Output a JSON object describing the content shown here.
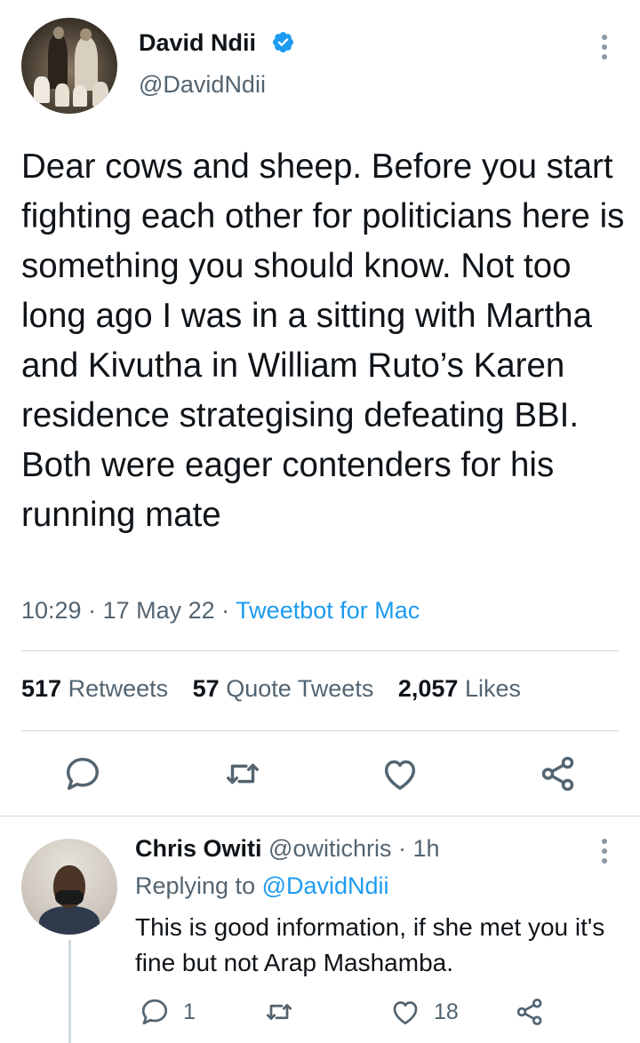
{
  "tweet": {
    "author_name": "David Ndii",
    "author_handle": "@DavidNdii",
    "text": "Dear cows and sheep. Before you start fighting each other for politicians here is something you should know. Not too long ago I was in a sitting with Martha and Kivutha in William Ruto’s Karen residence strategising defeating BBI. Both were eager contenders for his running mate",
    "time": "10:29",
    "date": "17 May 22",
    "separator": " · ",
    "source_app": "Tweetbot for Mac",
    "stats": {
      "retweets_count": "517",
      "retweets_label": "Retweets",
      "quotes_count": "57",
      "quotes_label": "Quote Tweets",
      "likes_count": "2,057",
      "likes_label": "Likes"
    }
  },
  "reply": {
    "author_name": "Chris Owiti",
    "author_handle": "@owitichris",
    "age": "1h",
    "replying_prefix": "Replying to",
    "replying_to": "@DavidNdii",
    "text": "This is good information, if she met you it's fine but not Arap Mashamba.",
    "reply_count": "1",
    "like_count": "18"
  },
  "icons": {
    "verified": "verified-badge-icon",
    "more": "more-vertical-icon",
    "reply": "reply-icon",
    "retweet": "retweet-icon",
    "like": "heart-icon",
    "share": "share-icon"
  },
  "colors": {
    "accent": "#1d9bf0",
    "text": "#0f1419",
    "secondary": "#536471",
    "divider": "#cfd9de"
  }
}
